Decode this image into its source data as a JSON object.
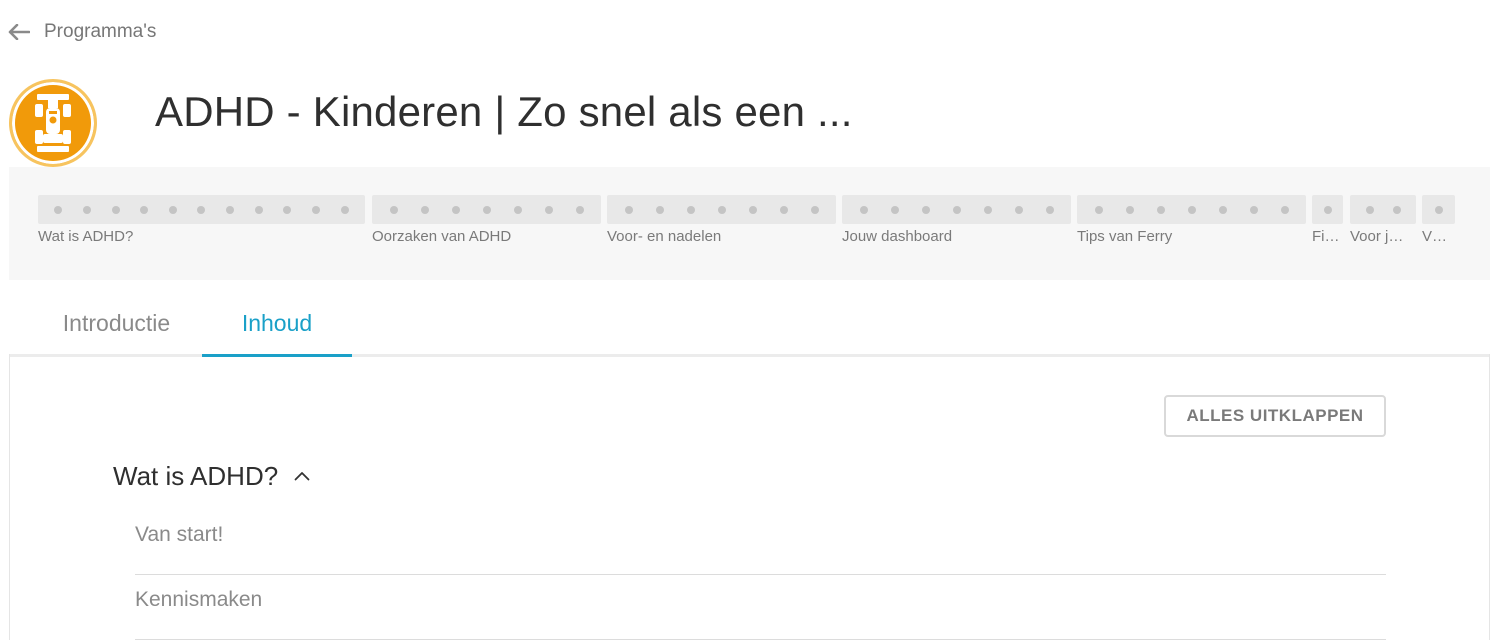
{
  "nav": {
    "back_label": "Programma's",
    "back_icon": "arrow-left-icon"
  },
  "program": {
    "title": "ADHD - Kinderen | Zo snel als een ...",
    "icon": "race-car-icon",
    "icon_color": "#f19a0a"
  },
  "progress": {
    "segments": [
      {
        "label": "Wat is ADHD?",
        "dots": 11
      },
      {
        "label": "Oorzaken van ADHD",
        "dots": 7
      },
      {
        "label": "Voor- en nadelen",
        "dots": 7
      },
      {
        "label": "Jouw dashboard",
        "dots": 7
      },
      {
        "label": "Tips van Ferry",
        "dots": 7
      },
      {
        "label": "Fi…",
        "dots": 1
      },
      {
        "label": "Voor j…",
        "dots": 2
      },
      {
        "label": "V…",
        "dots": 1
      }
    ]
  },
  "tabs": [
    {
      "label": "Introductie",
      "active": false
    },
    {
      "label": "Inhoud",
      "active": true
    }
  ],
  "accent_color": "#1aa0c8",
  "content": {
    "expand_all_label": "ALLES UITKLAPPEN",
    "section": {
      "title": "Wat is ADHD?",
      "toggle_icon": "chevron-up-icon",
      "items": [
        "Van start!",
        "Kennismaken"
      ]
    }
  }
}
